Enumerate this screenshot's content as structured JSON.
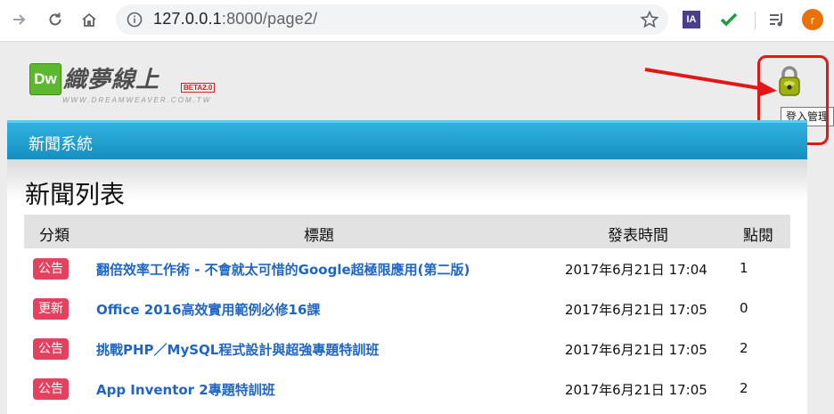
{
  "browser": {
    "url_host": "127.0.0.1",
    "url_rest": ":8000/page2/",
    "ext_ia": "IA",
    "avatar_letter": "r"
  },
  "site": {
    "logo_dw": "Dw",
    "logo_name": "織夢線上",
    "logo_beta": "BETA2.0",
    "logo_domain": "WWW.DREAMWEAVER.COM.TW"
  },
  "login": {
    "tooltip": "登入管理"
  },
  "panel": {
    "header": "新聞系統",
    "list_title": "新聞列表",
    "columns": [
      "分類",
      "標題",
      "發表時間",
      "點閱"
    ],
    "rows": [
      {
        "category": "公告",
        "title": "翻倍效率工作術 - 不會就太可惜的Google超極限應用(第二版)",
        "date": "2017年6月21日 17:04",
        "hits": "1"
      },
      {
        "category": "更新",
        "title": "Office 2016高效實用範例必修16課",
        "date": "2017年6月21日 17:05",
        "hits": "0"
      },
      {
        "category": "公告",
        "title": "挑戰PHP／MySQL程式設計與超強專題特訓班",
        "date": "2017年6月21日 17:05",
        "hits": "2"
      },
      {
        "category": "公告",
        "title": "App Inventor 2專題特訓班",
        "date": "2017年6月21日 17:05",
        "hits": "2"
      }
    ]
  },
  "colors": {
    "badge": "#e4405f",
    "header_blue": "#1e9fd0",
    "link": "#1f66c4",
    "annotation_red": "#e21818"
  }
}
